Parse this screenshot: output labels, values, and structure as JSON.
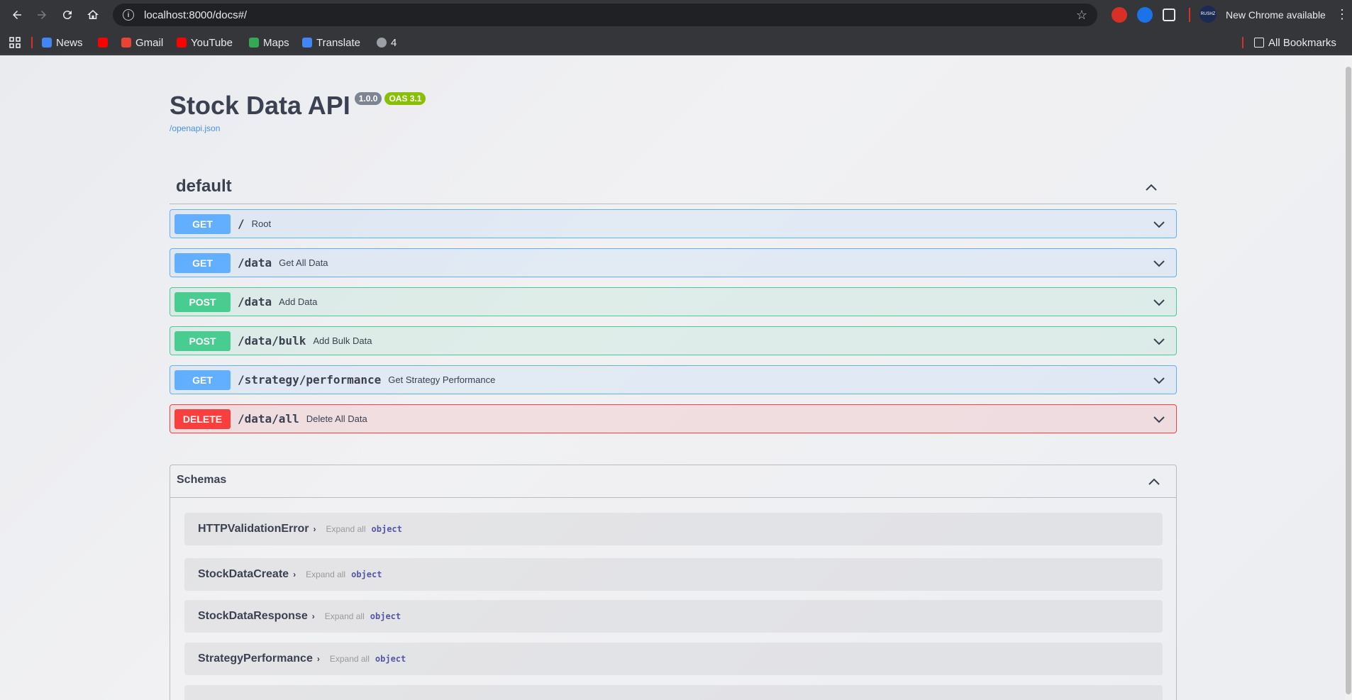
{
  "browser": {
    "url": "localhost:8000/docs#/",
    "update_label": "New Chrome available",
    "bookmarks": [
      {
        "label": "News",
        "color": "#4285f4"
      },
      {
        "label": "",
        "color": "#ff0000"
      },
      {
        "label": "Gmail",
        "color": "#ea4335"
      },
      {
        "label": "YouTube",
        "color": "#ff0000"
      },
      {
        "label": "Maps",
        "color": "#34a853"
      },
      {
        "label": "Translate",
        "color": "#4285f4"
      },
      {
        "label": "4",
        "color": "#9aa0a6"
      }
    ],
    "all_bookmarks": "All Bookmarks",
    "avatar_text": "RUSHZ"
  },
  "api": {
    "title": "Stock Data API",
    "version": "1.0.0",
    "oas": "OAS 3.1",
    "spec_link": "/openapi.json"
  },
  "tag": {
    "name": "default"
  },
  "operations": [
    {
      "method": "GET",
      "path": "/",
      "summary": "Root"
    },
    {
      "method": "GET",
      "path": "/data",
      "summary": "Get All Data"
    },
    {
      "method": "POST",
      "path": "/data",
      "summary": "Add Data"
    },
    {
      "method": "POST",
      "path": "/data/bulk",
      "summary": "Add Bulk Data"
    },
    {
      "method": "GET",
      "path": "/strategy/performance",
      "summary": "Get Strategy Performance"
    },
    {
      "method": "DELETE",
      "path": "/data/all",
      "summary": "Delete All Data"
    }
  ],
  "schemas": {
    "title": "Schemas",
    "expand_label": "Expand all",
    "items": [
      {
        "name": "HTTPValidationError",
        "type": "object"
      },
      {
        "name": "StockDataCreate",
        "type": "object"
      },
      {
        "name": "StockDataResponse",
        "type": "object"
      },
      {
        "name": "StrategyPerformance",
        "type": "object"
      }
    ]
  },
  "colors": {
    "get": "#61affe",
    "post": "#49cc90",
    "delete": "#f93e3e"
  }
}
